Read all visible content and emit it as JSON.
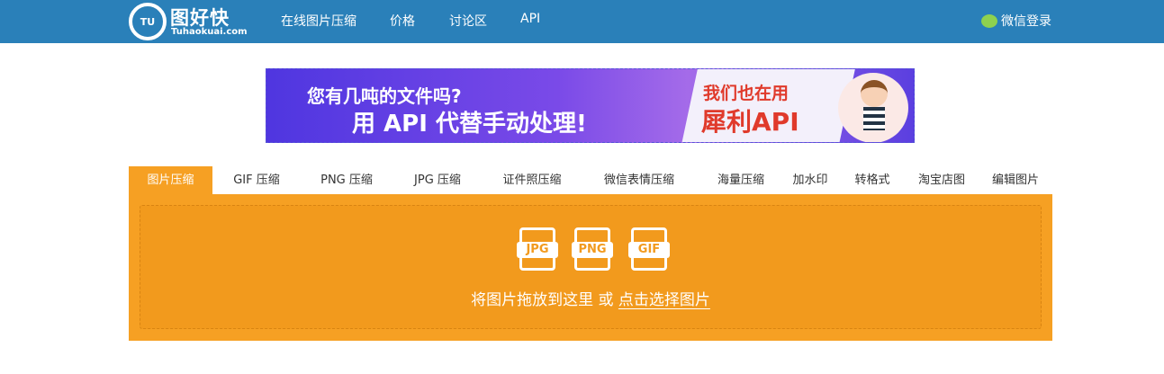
{
  "nav": {
    "logo_name": "图好快",
    "logo_url": "Tuhaokuai.com",
    "logo_mark": "TU",
    "items": [
      "在线图片压缩",
      "价格",
      "讨论区",
      "API"
    ],
    "login": "微信登录"
  },
  "banner": {
    "line1": "您有几吨的文件吗?",
    "line2": "用 API 代替手动处理!",
    "line3": "我们也在用",
    "line4": "犀利API"
  },
  "tabs": [
    "图片压缩",
    "GIF 压缩",
    "PNG 压缩",
    "JPG 压缩",
    "证件照压缩",
    "微信表情压缩",
    "海量压缩",
    "加水印",
    "转格式",
    "淘宝店图",
    "编辑图片"
  ],
  "drop": {
    "icons": [
      "JPG",
      "PNG",
      "GIF"
    ],
    "text": "将图片拖放到这里 或 ",
    "link": "点击选择图片"
  },
  "colors": {
    "nav": "#2a80b9",
    "accent": "#f6a023"
  }
}
